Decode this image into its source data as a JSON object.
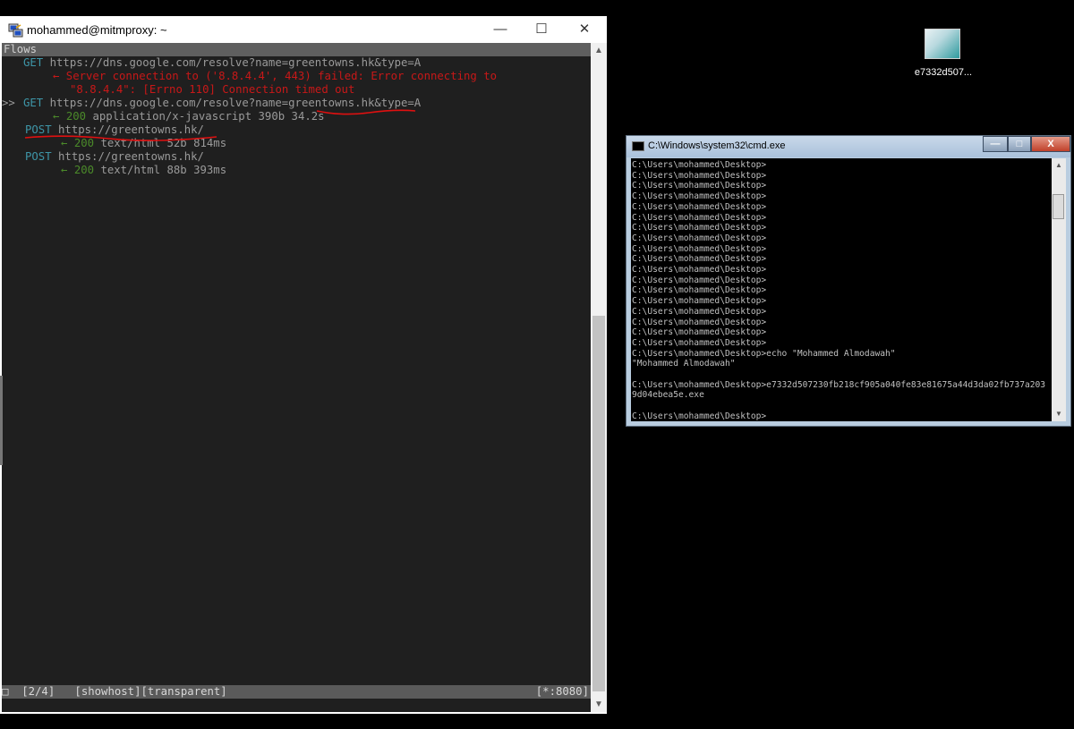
{
  "mitm_window": {
    "title": "mohammed@mitmproxy: ~",
    "controls": {
      "minimize": "—",
      "maximize": "☐",
      "close": "✕"
    },
    "header": "Flows",
    "flows": [
      {
        "marker": "",
        "method": "GET",
        "url": "https://dns.google.com/resolve?name=greentowns.hk&type=A",
        "response_lines": [
          "← Server connection to ('8.8.4.4', 443) failed: Error connecting to",
          "\"8.8.4.4\": [Errno 110] Connection timed out"
        ]
      },
      {
        "marker": ">>",
        "method": "GET",
        "url": "https://dns.google.com/resolve?name=greentowns.hk&type=A",
        "response": {
          "arrow": "←",
          "status": "200",
          "info": "application/x-javascript 390b 34.2s"
        }
      },
      {
        "marker": "",
        "method": "POST",
        "url": "https://greentowns.hk/",
        "response": {
          "arrow": "←",
          "status": "200",
          "info": "text/html 52b 814ms"
        }
      },
      {
        "marker": "",
        "method": "POST",
        "url": "https://greentowns.hk/",
        "response": {
          "arrow": "←",
          "status": "200",
          "info": "text/html 88b 393ms"
        }
      }
    ],
    "status_bar": {
      "left": "□  [2/4]   [showhost][transparent]",
      "right": "[*:8080]"
    }
  },
  "cmd_window": {
    "title": "C:\\Windows\\system32\\cmd.exe",
    "controls": {
      "minimize": "—",
      "maximize": "□",
      "close": "X"
    },
    "lines": [
      "C:\\Users\\mohammed\\Desktop>",
      "C:\\Users\\mohammed\\Desktop>",
      "C:\\Users\\mohammed\\Desktop>",
      "C:\\Users\\mohammed\\Desktop>",
      "C:\\Users\\mohammed\\Desktop>",
      "C:\\Users\\mohammed\\Desktop>",
      "C:\\Users\\mohammed\\Desktop>",
      "C:\\Users\\mohammed\\Desktop>",
      "C:\\Users\\mohammed\\Desktop>",
      "C:\\Users\\mohammed\\Desktop>",
      "C:\\Users\\mohammed\\Desktop>",
      "C:\\Users\\mohammed\\Desktop>",
      "C:\\Users\\mohammed\\Desktop>",
      "C:\\Users\\mohammed\\Desktop>",
      "C:\\Users\\mohammed\\Desktop>",
      "C:\\Users\\mohammed\\Desktop>",
      "C:\\Users\\mohammed\\Desktop>",
      "C:\\Users\\mohammed\\Desktop>",
      "C:\\Users\\mohammed\\Desktop>echo \"Mohammed Almodawah\"",
      "\"Mohammed Almodawah\"",
      "",
      "C:\\Users\\mohammed\\Desktop>e7332d507230fb218cf905a040fe83e81675a44d3da02fb737a203",
      "9d04ebea5e.exe",
      "",
      "C:\\Users\\mohammed\\Desktop>"
    ]
  },
  "desktop_icon": {
    "label": "e7332d507..."
  },
  "colors": {
    "terminal_bg": "#1f1f1f",
    "method": "#3e96a8",
    "error": "#c81818",
    "status_ok": "#4b8a2a",
    "annotation": "#e01010"
  }
}
